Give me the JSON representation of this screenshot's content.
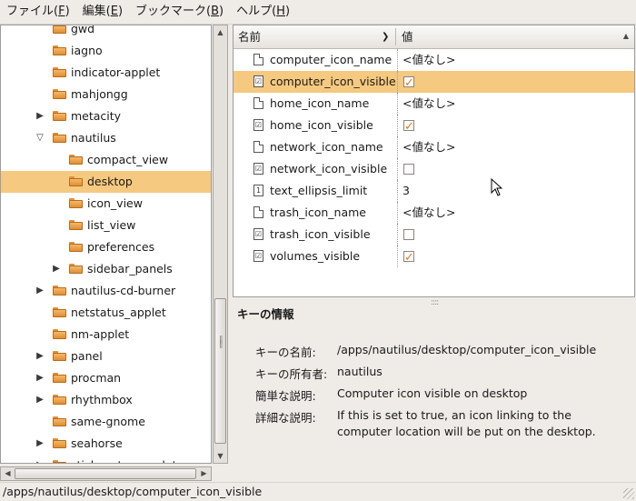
{
  "menubar": {
    "items": [
      {
        "label": "ファイル(",
        "acc": "F",
        "end": ")"
      },
      {
        "label": "編集(",
        "acc": "E",
        "end": ")"
      },
      {
        "label": "ブックマーク(",
        "acc": "B",
        "end": ")"
      },
      {
        "label": "ヘルプ(",
        "acc": "H",
        "end": ")"
      }
    ]
  },
  "tree": {
    "items": [
      {
        "label": "gwd",
        "level": 1,
        "expander": ""
      },
      {
        "label": "iagno",
        "level": 1,
        "expander": ""
      },
      {
        "label": "indicator-applet",
        "level": 1,
        "expander": ""
      },
      {
        "label": "mahjongg",
        "level": 1,
        "expander": ""
      },
      {
        "label": "metacity",
        "level": 1,
        "expander": "▶"
      },
      {
        "label": "nautilus",
        "level": 1,
        "expander": "▽"
      },
      {
        "label": "compact_view",
        "level": 2,
        "expander": ""
      },
      {
        "label": "desktop",
        "level": 2,
        "expander": "",
        "selected": true
      },
      {
        "label": "icon_view",
        "level": 2,
        "expander": ""
      },
      {
        "label": "list_view",
        "level": 2,
        "expander": ""
      },
      {
        "label": "preferences",
        "level": 2,
        "expander": ""
      },
      {
        "label": "sidebar_panels",
        "level": 2,
        "expander": "▶"
      },
      {
        "label": "nautilus-cd-burner",
        "level": 1,
        "expander": "▶"
      },
      {
        "label": "netstatus_applet",
        "level": 1,
        "expander": ""
      },
      {
        "label": "nm-applet",
        "level": 1,
        "expander": ""
      },
      {
        "label": "panel",
        "level": 1,
        "expander": "▶"
      },
      {
        "label": "procman",
        "level": 1,
        "expander": "▶"
      },
      {
        "label": "rhythmbox",
        "level": 1,
        "expander": "▶"
      },
      {
        "label": "same-gnome",
        "level": 1,
        "expander": ""
      },
      {
        "label": "seahorse",
        "level": 1,
        "expander": "▶"
      },
      {
        "label": "stickynotes_applet",
        "level": 1,
        "expander": "▶"
      }
    ]
  },
  "keylist": {
    "col_name": "名前",
    "col_value": "値",
    "rows": [
      {
        "name": "computer_icon_name",
        "type": "text",
        "value": "<値なし>"
      },
      {
        "name": "computer_icon_visible",
        "type": "bool",
        "checked": true,
        "selected": true
      },
      {
        "name": "home_icon_name",
        "type": "text",
        "value": "<値なし>"
      },
      {
        "name": "home_icon_visible",
        "type": "bool",
        "checked": true
      },
      {
        "name": "network_icon_name",
        "type": "text",
        "value": "<値なし>"
      },
      {
        "name": "network_icon_visible",
        "type": "bool",
        "checked": false
      },
      {
        "name": "text_ellipsis_limit",
        "type": "int",
        "value": "3"
      },
      {
        "name": "trash_icon_name",
        "type": "text",
        "value": "<値なし>"
      },
      {
        "name": "trash_icon_visible",
        "type": "bool",
        "checked": false
      },
      {
        "name": "volumes_visible",
        "type": "bool",
        "checked": true
      }
    ]
  },
  "info": {
    "title": "キーの情報",
    "name_label": "キーの名前:",
    "name_value": "/apps/nautilus/desktop/computer_icon_visible",
    "owner_label": "キーの所有者:",
    "owner_value": "nautilus",
    "short_label": "簡単な説明:",
    "short_value": "Computer icon visible on desktop",
    "long_label": "詳細な説明:",
    "long_value": "If this is set to true, an icon linking to the computer location will be put on the desktop."
  },
  "statusbar": {
    "text": "/apps/nautilus/desktop/computer_icon_visible"
  },
  "colors": {
    "selection": "#f5c97f",
    "folder": "#e8983c",
    "check": "#e0781c"
  }
}
